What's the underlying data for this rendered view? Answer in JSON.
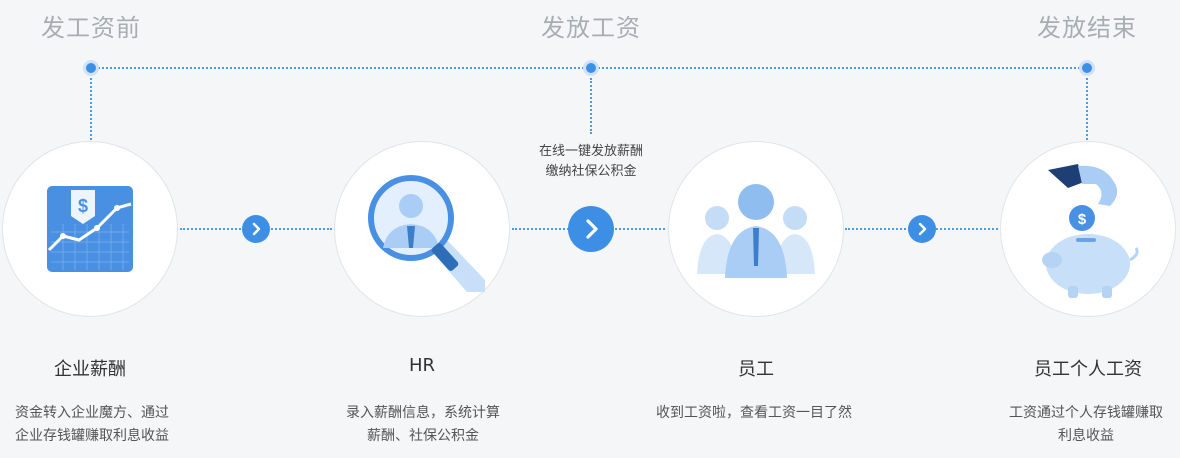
{
  "phases": [
    "发工资前",
    "发放工资",
    "发放结束"
  ],
  "middle_note": [
    "在线一键发放薪酬",
    "缴纳社保公积金"
  ],
  "steps": [
    {
      "label": "企业薪酬",
      "icon": "salary-chart-icon",
      "desc": [
        "资金转入企业魔方、通过",
        "企业存钱罐赚取利息收益"
      ]
    },
    {
      "label": "HR",
      "icon": "hr-magnifier-icon",
      "desc": [
        "录入薪酬信息，系统计算",
        "薪酬、社保公积金"
      ]
    },
    {
      "label": "员工",
      "icon": "employees-icon",
      "desc": [
        "收到工资啦，查看工资一目了然"
      ]
    },
    {
      "label": "员工个人工资",
      "icon": "piggy-bank-icon",
      "desc": [
        "工资通过个人存钱罐赚取",
        "利息收益"
      ]
    }
  ],
  "colors": {
    "accent": "#3d8fe6",
    "icon_light": "#a9cdf5",
    "phase_text": "#a9adb3"
  }
}
